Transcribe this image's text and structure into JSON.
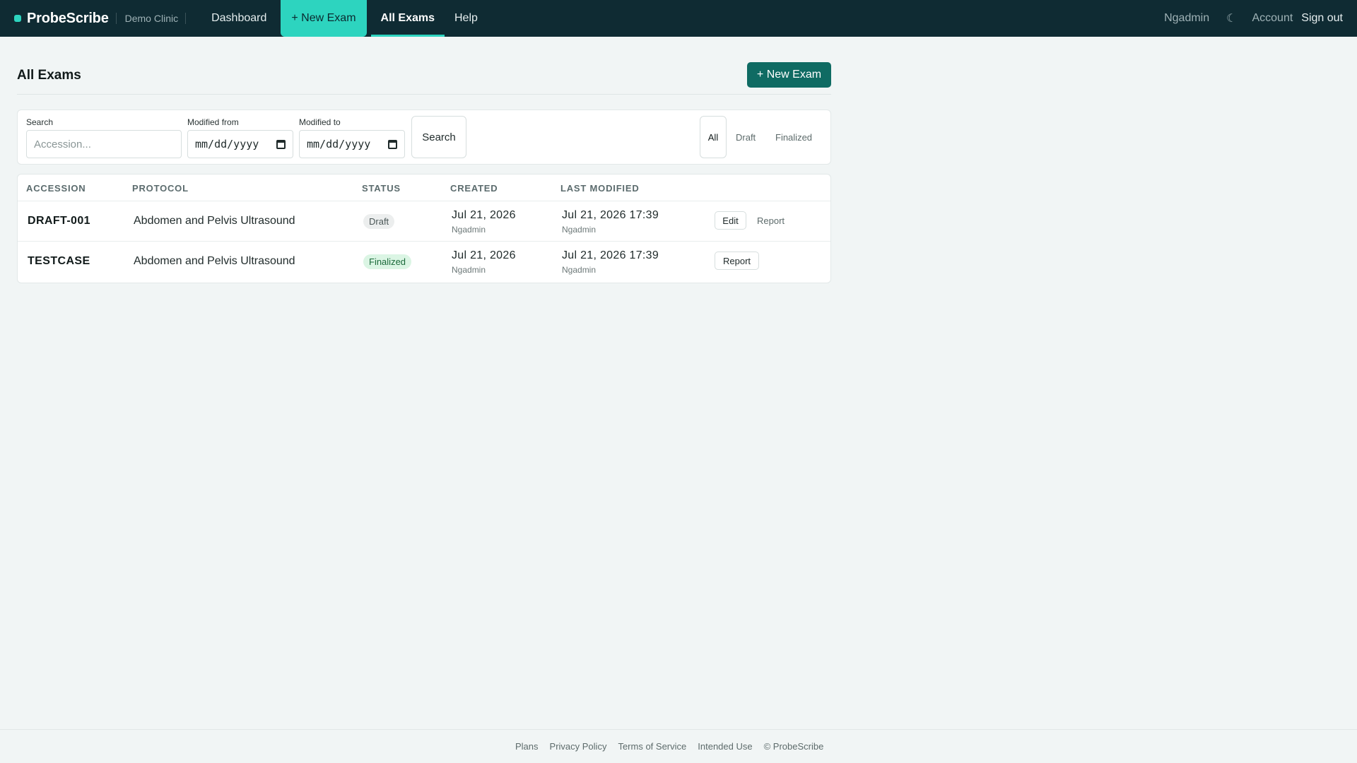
{
  "nav": {
    "brand": "ProbeScribe",
    "clinic": "Demo Clinic",
    "dashboard": "Dashboard",
    "new_exam": "+ New Exam",
    "all_exams": "All Exams",
    "help": "Help",
    "user": "Ngadmin",
    "theme_icon": "☾",
    "account": "Account",
    "sign_out": "Sign out"
  },
  "page": {
    "title": "All Exams",
    "new_exam_button": "+ New Exam"
  },
  "filters": {
    "search_label": "Search",
    "search_placeholder": "Accession...",
    "modified_from_label": "Modified from",
    "modified_from_value": "mm/dd/yyyy",
    "modified_to_label": "Modified to",
    "modified_to_value": "mm/dd/yyyy",
    "search_button": "Search",
    "status_tabs": [
      "All",
      "Draft",
      "Finalized"
    ]
  },
  "table": {
    "headers": [
      "ACCESSION",
      "PROTOCOL",
      "STATUS",
      "CREATED",
      "LAST MODIFIED"
    ],
    "rows": [
      {
        "accession": "DRAFT-001",
        "protocol": "Abdomen and Pelvis Ultrasound",
        "status": "Draft",
        "created": "Jul 21, 2026",
        "created_by": "Ngadmin",
        "modified": "Jul 21, 2026 17:39",
        "modified_by": "Ngadmin",
        "actions": [
          "Edit",
          "Report"
        ]
      },
      {
        "accession": "TESTCASE",
        "protocol": "Abdomen and Pelvis Ultrasound",
        "status": "Finalized",
        "created": "Jul 21, 2026",
        "created_by": "Ngadmin",
        "modified": "Jul 21, 2026 17:39",
        "modified_by": "Ngadmin",
        "actions": [
          "Report"
        ]
      }
    ]
  },
  "footer": {
    "links": [
      "Plans",
      "Privacy Policy",
      "Terms of Service",
      "Intended Use"
    ],
    "copyright": "© ProbeScribe"
  },
  "colors": {
    "nav_bg": "#0f2b33",
    "accent": "#2dd4bf",
    "primary_button": "#0f6b63",
    "page_bg": "#f1f5f5"
  }
}
